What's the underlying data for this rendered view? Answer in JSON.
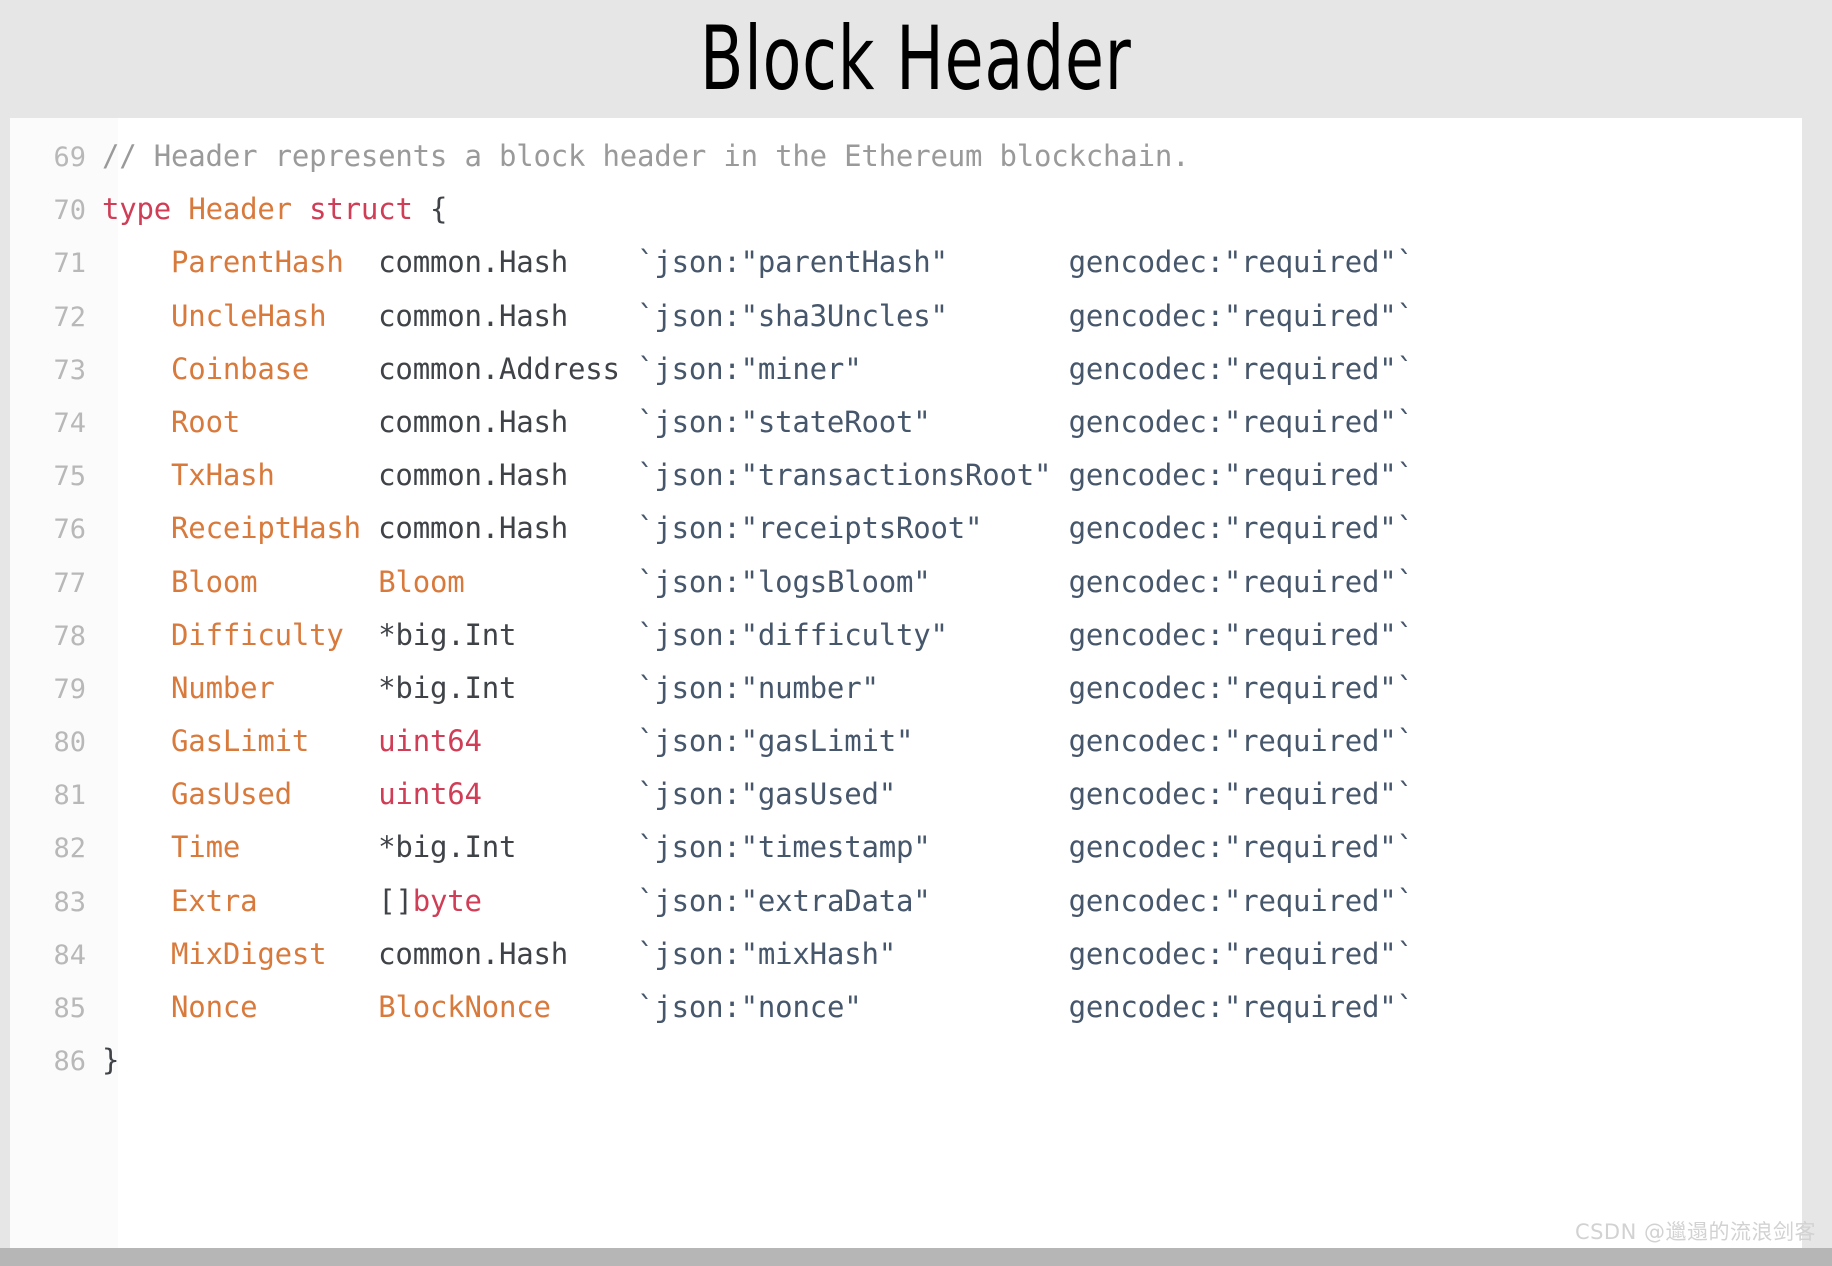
{
  "slide": {
    "title": "Block Header",
    "background_color": "#e6e6e6",
    "panel_color": "#ffffff"
  },
  "watermark": {
    "text": "CSDN @邋遢的流浪剑客"
  },
  "colors": {
    "comment": "#9a9a9a",
    "keyword": "#cf3e56",
    "field_name": "#d97a3d",
    "user_type": "#d97a3d",
    "builtin_type": "#cf3e56",
    "plain_type": "#3f4348",
    "struct_tag": "#46566b",
    "line_number": "#b8b8b8",
    "bottom_bar": "#b6b6b6"
  },
  "code": {
    "language": "go",
    "first_line_number": 69,
    "last_line_number": 86,
    "lines": [
      {
        "number": "69",
        "tokens": [
          {
            "text": "// Header represents a block header in the Ethereum blockchain.",
            "cls": "tok-comment"
          }
        ]
      },
      {
        "number": "70",
        "tokens": [
          {
            "text": "type",
            "cls": "tok-keyword"
          },
          {
            "text": " ",
            "cls": "tok-punct"
          },
          {
            "text": "Header",
            "cls": "tok-ident"
          },
          {
            "text": " ",
            "cls": "tok-punct"
          },
          {
            "text": "struct",
            "cls": "tok-keyword"
          },
          {
            "text": " {",
            "cls": "tok-punct"
          }
        ]
      },
      {
        "number": "71",
        "tokens": [
          {
            "text": "    ",
            "cls": "tok-punct"
          },
          {
            "text": "ParentHash",
            "cls": "tok-ident"
          },
          {
            "text": "  ",
            "cls": "tok-punct"
          },
          {
            "text": "common.Hash",
            "cls": "tok-type"
          },
          {
            "text": "    ",
            "cls": "tok-punct"
          },
          {
            "text": "`json:\"parentHash\"       gencodec:\"required\"`",
            "cls": "tok-tag"
          }
        ]
      },
      {
        "number": "72",
        "tokens": [
          {
            "text": "    ",
            "cls": "tok-punct"
          },
          {
            "text": "UncleHash",
            "cls": "tok-ident"
          },
          {
            "text": "   ",
            "cls": "tok-punct"
          },
          {
            "text": "common.Hash",
            "cls": "tok-type"
          },
          {
            "text": "    ",
            "cls": "tok-punct"
          },
          {
            "text": "`json:\"sha3Uncles\"       gencodec:\"required\"`",
            "cls": "tok-tag"
          }
        ]
      },
      {
        "number": "73",
        "tokens": [
          {
            "text": "    ",
            "cls": "tok-punct"
          },
          {
            "text": "Coinbase",
            "cls": "tok-ident"
          },
          {
            "text": "    ",
            "cls": "tok-punct"
          },
          {
            "text": "common.Address",
            "cls": "tok-type"
          },
          {
            "text": " ",
            "cls": "tok-punct"
          },
          {
            "text": "`json:\"miner\"            gencodec:\"required\"`",
            "cls": "tok-tag"
          }
        ]
      },
      {
        "number": "74",
        "tokens": [
          {
            "text": "    ",
            "cls": "tok-punct"
          },
          {
            "text": "Root",
            "cls": "tok-ident"
          },
          {
            "text": "        ",
            "cls": "tok-punct"
          },
          {
            "text": "common.Hash",
            "cls": "tok-type"
          },
          {
            "text": "    ",
            "cls": "tok-punct"
          },
          {
            "text": "`json:\"stateRoot\"        gencodec:\"required\"`",
            "cls": "tok-tag"
          }
        ]
      },
      {
        "number": "75",
        "tokens": [
          {
            "text": "    ",
            "cls": "tok-punct"
          },
          {
            "text": "TxHash",
            "cls": "tok-ident"
          },
          {
            "text": "      ",
            "cls": "tok-punct"
          },
          {
            "text": "common.Hash",
            "cls": "tok-type"
          },
          {
            "text": "    ",
            "cls": "tok-punct"
          },
          {
            "text": "`json:\"transactionsRoot\" gencodec:\"required\"`",
            "cls": "tok-tag"
          }
        ]
      },
      {
        "number": "76",
        "tokens": [
          {
            "text": "    ",
            "cls": "tok-punct"
          },
          {
            "text": "ReceiptHash",
            "cls": "tok-ident"
          },
          {
            "text": " ",
            "cls": "tok-punct"
          },
          {
            "text": "common.Hash",
            "cls": "tok-type"
          },
          {
            "text": "    ",
            "cls": "tok-punct"
          },
          {
            "text": "`json:\"receiptsRoot\"     gencodec:\"required\"`",
            "cls": "tok-tag"
          }
        ]
      },
      {
        "number": "77",
        "tokens": [
          {
            "text": "    ",
            "cls": "tok-punct"
          },
          {
            "text": "Bloom",
            "cls": "tok-ident"
          },
          {
            "text": "       ",
            "cls": "tok-punct"
          },
          {
            "text": "Bloom",
            "cls": "tok-usertype"
          },
          {
            "text": "          ",
            "cls": "tok-punct"
          },
          {
            "text": "`json:\"logsBloom\"        gencodec:\"required\"`",
            "cls": "tok-tag"
          }
        ]
      },
      {
        "number": "78",
        "tokens": [
          {
            "text": "    ",
            "cls": "tok-punct"
          },
          {
            "text": "Difficulty",
            "cls": "tok-ident"
          },
          {
            "text": "  ",
            "cls": "tok-punct"
          },
          {
            "text": "*big.Int",
            "cls": "tok-type"
          },
          {
            "text": "       ",
            "cls": "tok-punct"
          },
          {
            "text": "`json:\"difficulty\"       gencodec:\"required\"`",
            "cls": "tok-tag"
          }
        ]
      },
      {
        "number": "79",
        "tokens": [
          {
            "text": "    ",
            "cls": "tok-punct"
          },
          {
            "text": "Number",
            "cls": "tok-ident"
          },
          {
            "text": "      ",
            "cls": "tok-punct"
          },
          {
            "text": "*big.Int",
            "cls": "tok-type"
          },
          {
            "text": "       ",
            "cls": "tok-punct"
          },
          {
            "text": "`json:\"number\"           gencodec:\"required\"`",
            "cls": "tok-tag"
          }
        ]
      },
      {
        "number": "80",
        "tokens": [
          {
            "text": "    ",
            "cls": "tok-punct"
          },
          {
            "text": "GasLimit",
            "cls": "tok-ident"
          },
          {
            "text": "    ",
            "cls": "tok-punct"
          },
          {
            "text": "uint64",
            "cls": "tok-builtin"
          },
          {
            "text": "         ",
            "cls": "tok-punct"
          },
          {
            "text": "`json:\"gasLimit\"         gencodec:\"required\"`",
            "cls": "tok-tag"
          }
        ]
      },
      {
        "number": "81",
        "tokens": [
          {
            "text": "    ",
            "cls": "tok-punct"
          },
          {
            "text": "GasUsed",
            "cls": "tok-ident"
          },
          {
            "text": "     ",
            "cls": "tok-punct"
          },
          {
            "text": "uint64",
            "cls": "tok-builtin"
          },
          {
            "text": "         ",
            "cls": "tok-punct"
          },
          {
            "text": "`json:\"gasUsed\"          gencodec:\"required\"`",
            "cls": "tok-tag"
          }
        ]
      },
      {
        "number": "82",
        "tokens": [
          {
            "text": "    ",
            "cls": "tok-punct"
          },
          {
            "text": "Time",
            "cls": "tok-ident"
          },
          {
            "text": "        ",
            "cls": "tok-punct"
          },
          {
            "text": "*big.Int",
            "cls": "tok-type"
          },
          {
            "text": "       ",
            "cls": "tok-punct"
          },
          {
            "text": "`json:\"timestamp\"        gencodec:\"required\"`",
            "cls": "tok-tag"
          }
        ]
      },
      {
        "number": "83",
        "tokens": [
          {
            "text": "    ",
            "cls": "tok-punct"
          },
          {
            "text": "Extra",
            "cls": "tok-ident"
          },
          {
            "text": "       ",
            "cls": "tok-punct"
          },
          {
            "text": "[]",
            "cls": "tok-punct"
          },
          {
            "text": "byte",
            "cls": "tok-builtin"
          },
          {
            "text": "         ",
            "cls": "tok-punct"
          },
          {
            "text": "`json:\"extraData\"        gencodec:\"required\"`",
            "cls": "tok-tag"
          }
        ]
      },
      {
        "number": "84",
        "tokens": [
          {
            "text": "    ",
            "cls": "tok-punct"
          },
          {
            "text": "MixDigest",
            "cls": "tok-ident"
          },
          {
            "text": "   ",
            "cls": "tok-punct"
          },
          {
            "text": "common.Hash",
            "cls": "tok-type"
          },
          {
            "text": "    ",
            "cls": "tok-punct"
          },
          {
            "text": "`json:\"mixHash\"          gencodec:\"required\"`",
            "cls": "tok-tag"
          }
        ]
      },
      {
        "number": "85",
        "tokens": [
          {
            "text": "    ",
            "cls": "tok-punct"
          },
          {
            "text": "Nonce",
            "cls": "tok-ident"
          },
          {
            "text": "       ",
            "cls": "tok-punct"
          },
          {
            "text": "BlockNonce",
            "cls": "tok-usertype"
          },
          {
            "text": "     ",
            "cls": "tok-punct"
          },
          {
            "text": "`json:\"nonce\"            gencodec:\"required\"`",
            "cls": "tok-tag"
          }
        ]
      },
      {
        "number": "86",
        "tokens": [
          {
            "text": "}",
            "cls": "tok-punct"
          }
        ]
      }
    ]
  },
  "struct_fields": [
    {
      "name": "ParentHash",
      "type": "common.Hash",
      "json_tag": "parentHash",
      "gencodec": "required"
    },
    {
      "name": "UncleHash",
      "type": "common.Hash",
      "json_tag": "sha3Uncles",
      "gencodec": "required"
    },
    {
      "name": "Coinbase",
      "type": "common.Address",
      "json_tag": "miner",
      "gencodec": "required"
    },
    {
      "name": "Root",
      "type": "common.Hash",
      "json_tag": "stateRoot",
      "gencodec": "required"
    },
    {
      "name": "TxHash",
      "type": "common.Hash",
      "json_tag": "transactionsRoot",
      "gencodec": "required"
    },
    {
      "name": "ReceiptHash",
      "type": "common.Hash",
      "json_tag": "receiptsRoot",
      "gencodec": "required"
    },
    {
      "name": "Bloom",
      "type": "Bloom",
      "json_tag": "logsBloom",
      "gencodec": "required"
    },
    {
      "name": "Difficulty",
      "type": "*big.Int",
      "json_tag": "difficulty",
      "gencodec": "required"
    },
    {
      "name": "Number",
      "type": "*big.Int",
      "json_tag": "number",
      "gencodec": "required"
    },
    {
      "name": "GasLimit",
      "type": "uint64",
      "json_tag": "gasLimit",
      "gencodec": "required"
    },
    {
      "name": "GasUsed",
      "type": "uint64",
      "json_tag": "gasUsed",
      "gencodec": "required"
    },
    {
      "name": "Time",
      "type": "*big.Int",
      "json_tag": "timestamp",
      "gencodec": "required"
    },
    {
      "name": "Extra",
      "type": "[]byte",
      "json_tag": "extraData",
      "gencodec": "required"
    },
    {
      "name": "MixDigest",
      "type": "common.Hash",
      "json_tag": "mixHash",
      "gencodec": "required"
    },
    {
      "name": "Nonce",
      "type": "BlockNonce",
      "json_tag": "nonce",
      "gencodec": "required"
    }
  ]
}
